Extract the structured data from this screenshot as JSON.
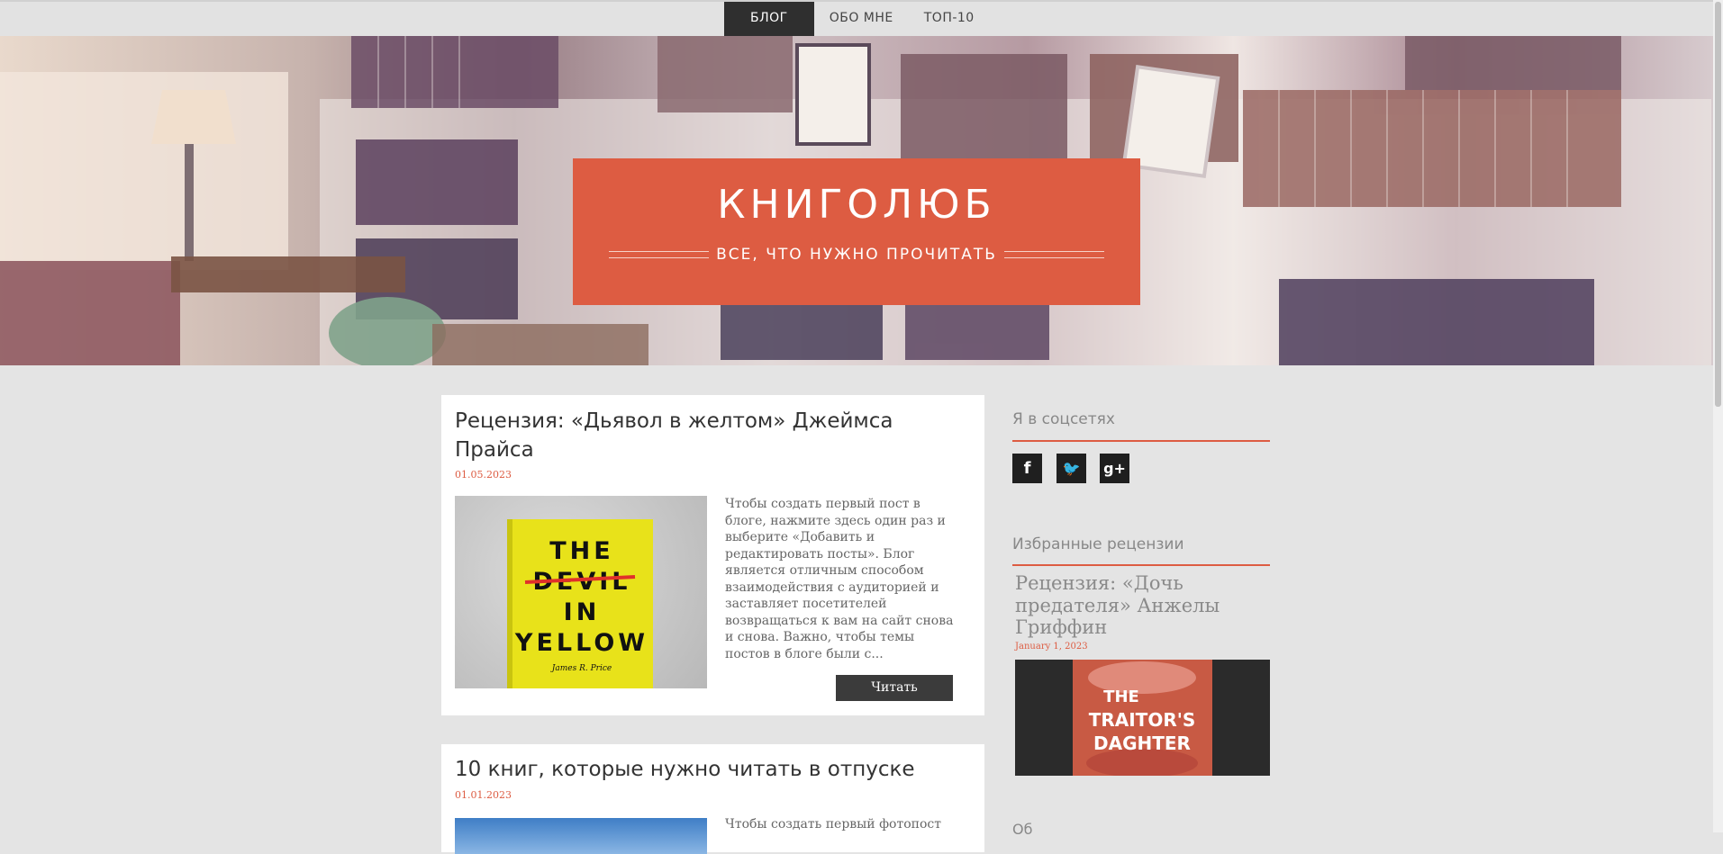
{
  "nav": {
    "items": [
      {
        "label": "БЛОГ",
        "active": true
      },
      {
        "label": "ОБО МНЕ",
        "active": false
      },
      {
        "label": "ТОП-10",
        "active": false
      }
    ]
  },
  "header": {
    "title": "КНИГОЛЮБ",
    "tagline": "ВСЕ, ЧТО НУЖНО ПРОЧИТАТЬ",
    "accent_color": "#dd5c42"
  },
  "posts": [
    {
      "title": "Рецензия: «Дьявол в желтом» Джеймса Прайса",
      "date": "01.05.2023",
      "excerpt": "Чтобы создать первый пост в блоге, нажмите здесь один раз и выберите «Добавить и редактировать посты». Блог является отличным способом взаимодействия с аудиторией и заставляет посетителей возвращаться к вам на сайт снова и снова. Важно, чтобы темы постов в блоге были с...",
      "read_label": "Читать",
      "cover": {
        "line1": "THE",
        "line2": "DEVIL",
        "line3": "IN",
        "line4": "YELLOW",
        "author": "James R. Price"
      }
    },
    {
      "title": "10 книг, которые нужно читать в отпуске",
      "date": "01.01.2023",
      "excerpt": "Чтобы создать первый фотопост"
    }
  ],
  "sidebar": {
    "social_heading": "Я в соцсетях",
    "social": [
      {
        "icon": "facebook-icon",
        "glyph": "f"
      },
      {
        "icon": "twitter-icon",
        "glyph": "🐦"
      },
      {
        "icon": "google-plus-icon",
        "glyph": "g+"
      }
    ],
    "featured_heading": "Избранные рецензии",
    "featured": {
      "title": "Рецензия: «Дочь предателя» Анжелы Гриффин",
      "date": "January 1, 2023",
      "cover": {
        "line1": "THE",
        "line2": "TRAITOR'S",
        "line3": "DAGHTER"
      }
    },
    "next_heading_partial": "Об"
  }
}
